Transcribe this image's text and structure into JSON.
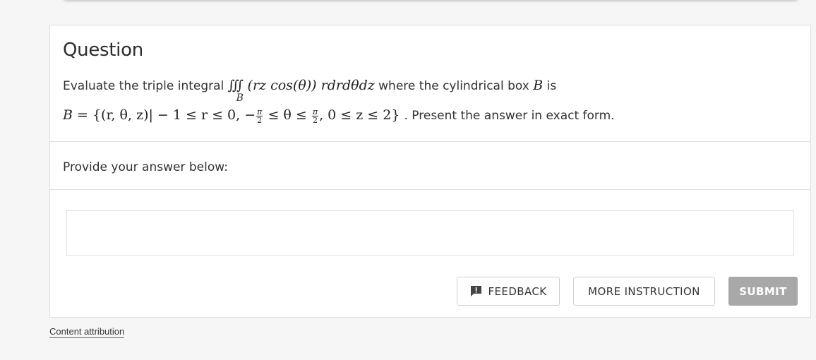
{
  "question": {
    "title": "Question",
    "line1_prefix": "Evaluate the triple integral",
    "integral_symbol": "∭",
    "integral_subscript": "B",
    "integrand": "(rz cos(θ)) rdrdθdz",
    "line1_middle": "where the cylindrical box",
    "box_symbol": "B",
    "line1_suffix": "is",
    "set_lhs": "B =",
    "set_open": "{(r, θ, z)| − 1 ≤ r ≤ 0, −",
    "frac_num": "π",
    "frac_den": "2",
    "set_mid": "≤ θ ≤",
    "set_tail": ", 0 ≤ z ≤ 2}",
    "line2_suffix": ". Present the answer in exact form."
  },
  "prompt": {
    "text": "Provide your answer below:"
  },
  "answer": {
    "value": "",
    "placeholder": ""
  },
  "buttons": {
    "feedback_label": "FEEDBACK",
    "feedback_icon": "chat-alert-icon",
    "more_label": "MORE INSTRUCTION",
    "submit_label": "SUBMIT"
  },
  "footer": {
    "attribution_label": "Content attribution"
  },
  "colors": {
    "submit_bg": "#a8a8a8",
    "link_underline": "#1a7fb0",
    "page_bg": "#f6f6f6"
  }
}
